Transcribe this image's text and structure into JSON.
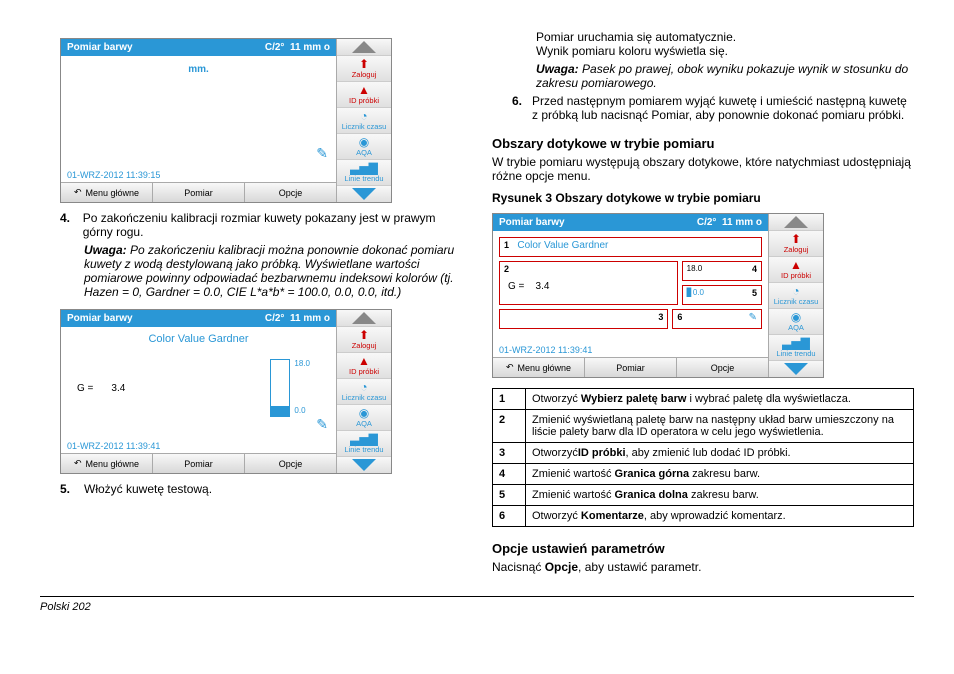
{
  "device": {
    "title": "Pomiar barwy",
    "meta_c": "C/2°",
    "meta_mm": "11 mm o",
    "mm_label": "mm.",
    "date1": "01-WRZ-2012  11:39:15",
    "date2": "01-WRZ-2012  11:39:41",
    "date3": "01-WRZ-2012  11:39:41",
    "cv_title": "Color Value Gardner",
    "g_label": "G =",
    "g_value": "3.4",
    "gauge_high": "18.0",
    "gauge_low": "0.0",
    "menu": "Menu główne",
    "pomiar": "Pomiar",
    "opcje": "Opcje",
    "side": {
      "zaloguj": "Zaloguj",
      "id_probki": "ID próbki",
      "licznik": "Licznik czasu",
      "aqa": "AQA",
      "linie": "Linie trendu"
    }
  },
  "left": {
    "step4_num": "4.",
    "step4": "Po zakończeniu kalibracji rozmiar kuwety pokazany jest w prawym górny rogu.",
    "note_label": "Uwaga:",
    "note": " Po zakończeniu kalibracji można ponownie dokonać pomiaru kuwety z wodą destylowaną jako próbką. Wyświetlane wartości pomiarowe powinny odpowiadać bezbarwnemu indeksowi kolorów (tj. Hazen = 0, Gardner = 0.0, CIE L*a*b* = 100.0, 0.0, 0.0, itd.)",
    "step5_num": "5.",
    "step5": "Włożyć kuwetę testową."
  },
  "right": {
    "p1": "Pomiar uruchamia się automatycznie.",
    "p2": "Wynik pomiaru koloru wyświetla się.",
    "note_label": "Uwaga:",
    "note": " Pasek po prawej, obok wyniku pokazuje wynik w stosunku do zakresu pomiarowego.",
    "step6_num": "6.",
    "step6": "Przed następnym pomiarem wyjąć kuwetę i umieścić następną kuwetę z próbką lub nacisnąć Pomiar, aby ponownie dokonać pomiaru próbki.",
    "h_touch": "Obszary dotykowe w trybie pomiaru",
    "touch_desc": "W trybie pomiaru występują obszary dotykowe, które natychmiast udostępniają różne opcje menu.",
    "fig_caption": "Rysunek 3 Obszary dotykowe w trybie pomiaru",
    "touch_labels": {
      "l1": "1",
      "l2": "2",
      "l3": "3",
      "l4": "4",
      "l5": "5",
      "l6": "6"
    },
    "legend": [
      {
        "n": "1",
        "pre": "Otworzyć ",
        "b": "Wybierz paletę barw",
        "post": " i wybrać paletę dla wyświetlacza."
      },
      {
        "n": "2",
        "pre": "Zmienić wyświetlaną paletę barw na następny układ barw umieszczony na liście palety barw dla ID operatora w celu jego wyświetlenia.",
        "b": "",
        "post": ""
      },
      {
        "n": "3",
        "pre": "Otworzyć",
        "b": "ID próbki",
        "post": ", aby zmienić lub dodać ID próbki."
      },
      {
        "n": "4",
        "pre": "Zmienić wartość ",
        "b": "Granica górna",
        "post": " zakresu barw."
      },
      {
        "n": "5",
        "pre": "Zmienić wartość ",
        "b": "Granica dolna",
        "post": " zakresu barw."
      },
      {
        "n": "6",
        "pre": "Otworzyć ",
        "b": "Komentarze",
        "post": ", aby wprowadzić komentarz."
      }
    ],
    "h_opt": "Opcje ustawień parametrów",
    "opt_desc_pre": "Nacisnąć ",
    "opt_desc_b": "Opcje",
    "opt_desc_post": ", aby ustawić parametr."
  },
  "footer": {
    "lang": "Polski",
    "page": " 202"
  }
}
